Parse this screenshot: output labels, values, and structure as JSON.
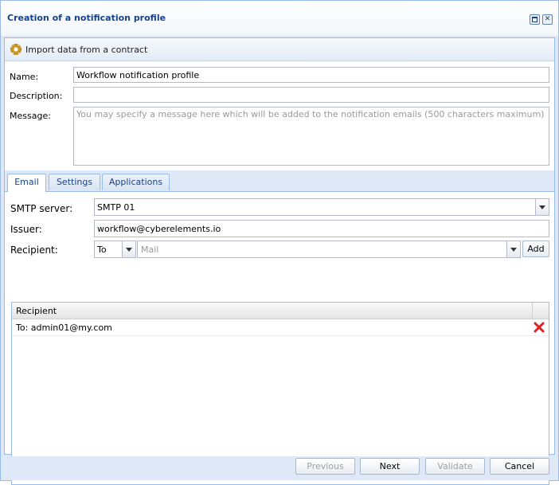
{
  "window": {
    "title": "Creation of a notification profile"
  },
  "toolbar": {
    "import_label": "Import data from a contract"
  },
  "form": {
    "name_label": "Name:",
    "name_value": "Workflow notification profile",
    "description_label": "Description:",
    "description_value": "",
    "message_label": "Message:",
    "message_placeholder": "You may specify a message here which will be added to the notification emails (500 characters maximum)"
  },
  "tabs": [
    {
      "label": "Email",
      "active": true
    },
    {
      "label": "Settings",
      "active": false
    },
    {
      "label": "Applications",
      "active": false
    }
  ],
  "email": {
    "smtp_label": "SMTP server:",
    "smtp_value": "SMTP 01",
    "issuer_label": "Issuer:",
    "issuer_value": "workflow@cyberelements.io",
    "recipient_label": "Recipient:",
    "recipient_type": "To",
    "mail_placeholder": "Mail",
    "add_label": "Add"
  },
  "grid": {
    "column": "Recipient",
    "rows": [
      {
        "value": "To: admin01@my.com"
      }
    ]
  },
  "footer": {
    "previous_label": "Previous",
    "next_label": "Next",
    "validate_label": "Validate",
    "cancel_label": "Cancel"
  },
  "colors": {
    "title": "#15428b",
    "border": "#99bbe8",
    "background": "#dfe8f6",
    "delete": "#e02020"
  }
}
